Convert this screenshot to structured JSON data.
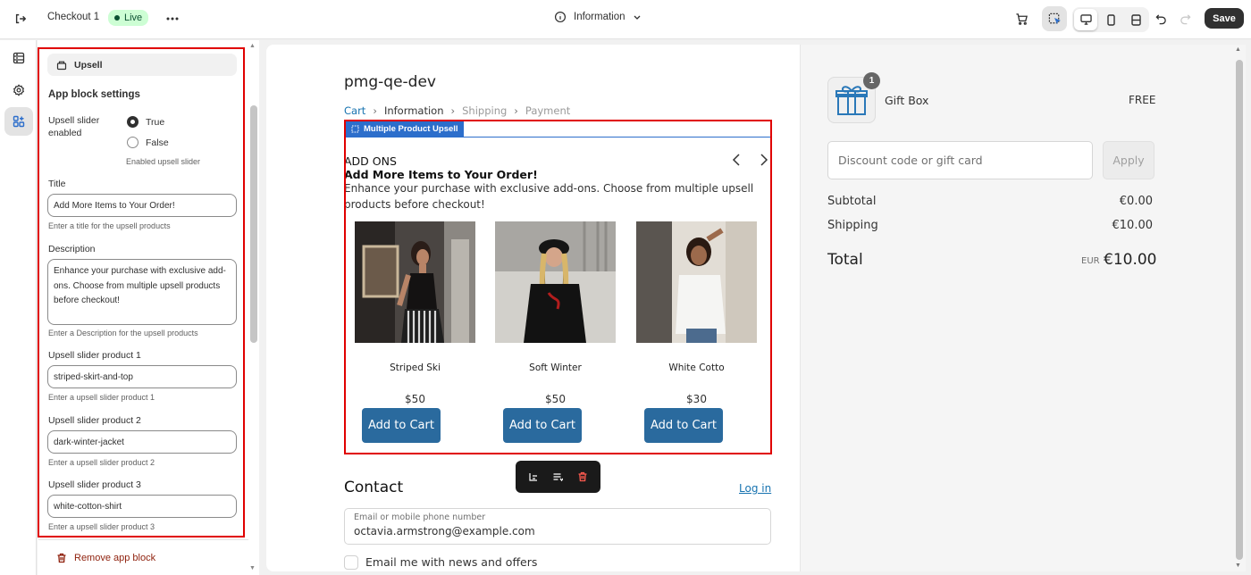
{
  "topbar": {
    "page_name": "Checkout 1",
    "status": "Live",
    "page_selector": "Information",
    "save_label": "Save"
  },
  "panel": {
    "block_name": "Upsell",
    "heading": "App block settings",
    "enabled_label": "Upsell slider enabled",
    "option_true": "True",
    "option_false": "False",
    "enabled_selected": "True",
    "enabled_hint": "Enabled upsell slider",
    "title_label": "Title",
    "title_value": "Add More Items to Your Order!",
    "title_hint": "Enter a title for the upsell products",
    "description_label": "Description",
    "description_value": "Enhance your purchase with exclusive add-ons. Choose from multiple upsell products before checkout!",
    "description_hint": "Enter a Description for the upsell products",
    "product1_label": "Upsell slider product 1",
    "product1_value": "striped-skirt-and-top",
    "product1_hint": "Enter a upsell slider product 1",
    "product2_label": "Upsell slider product 2",
    "product2_value": "dark-winter-jacket",
    "product2_hint": "Enter a upsell slider product 2",
    "product3_label": "Upsell slider product 3",
    "product3_value": "white-cotton-shirt",
    "product3_hint": "Enter a upsell slider product 3",
    "remove_label": "Remove app block"
  },
  "checkout": {
    "store_name": "pmg-qe-dev",
    "breadcrumb": [
      "Cart",
      "Information",
      "Shipping",
      "Payment"
    ],
    "block_tag": "Multiple Product Upsell",
    "upsell_heading": "ADD ONS",
    "upsell_title": "Add More Items to Your Order!",
    "upsell_description": "Enhance your purchase with exclusive add-ons. Choose from multiple upsell products before checkout!",
    "products": [
      {
        "name": "Striped Ski",
        "price": "$50",
        "button": "Add to Cart"
      },
      {
        "name": "Soft Winter",
        "price": "$50",
        "button": "Add to Cart"
      },
      {
        "name": "White Cotto",
        "price": "$30",
        "button": "Add to Cart"
      }
    ],
    "contact_heading": "Contact",
    "login_link": "Log in",
    "email_label": "Email or mobile phone number",
    "email_value": "octavia.armstrong@example.com",
    "newsletter_label": "Email me with news and offers"
  },
  "summary": {
    "item_name": "Gift Box",
    "item_qty": "1",
    "item_price": "FREE",
    "discount_placeholder": "Discount code or gift card",
    "apply_label": "Apply",
    "subtotal_label": "Subtotal",
    "subtotal_value": "€0.00",
    "shipping_label": "Shipping",
    "shipping_value": "€10.00",
    "total_label": "Total",
    "currency": "EUR",
    "total_value": "€10.00"
  },
  "colors": {
    "highlight": "#e00000",
    "button_blue": "#2a6a9e",
    "tag_blue": "#2c6ecb",
    "live_green": "#cdfed4"
  },
  "icons": [
    "exit-icon",
    "more-icon",
    "info-icon",
    "chevron-down-icon",
    "cart-icon",
    "select-icon",
    "desktop-icon",
    "mobile-icon",
    "fullwidth-icon",
    "undo-icon",
    "redo-icon",
    "sections-icon",
    "settings-icon",
    "apps-icon",
    "block-icon",
    "trash-icon",
    "chevron-left-icon",
    "chevron-right-icon",
    "gift-icon"
  ]
}
